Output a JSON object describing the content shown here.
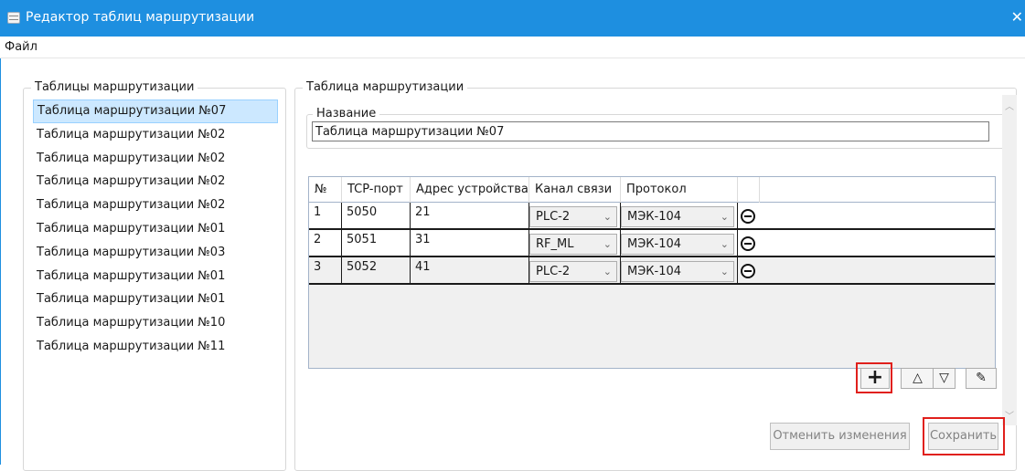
{
  "window": {
    "title": "Редактор таблиц маршрутизации",
    "close_glyph": "✕",
    "accent_color": "#1e8fe0",
    "icon": "table-app-icon"
  },
  "menu": {
    "file_label": "Файл"
  },
  "routes_panel": {
    "title": "Таблицы маршрутизации",
    "items": [
      "Таблица маршрутизации №07",
      "Таблица маршрутизации №02",
      "Таблица маршрутизации №02",
      "Таблица маршрутизации №02",
      "Таблица маршрутизации №02",
      "Таблица маршрутизации №01",
      "Таблица маршрутизации №03",
      "Таблица маршрутизации №01",
      "Таблица маршрутизации №01",
      "Таблица маршрутизации №10",
      "Таблица маршрутизации №11"
    ],
    "selected_index": 0
  },
  "table_panel": {
    "title": "Таблица маршрутизации",
    "name_label": "Название",
    "name_value": "Таблица маршрутизации №07",
    "columns": [
      "№",
      "TCP-порт",
      "Адрес устройства",
      "Канал связи",
      "Протокол"
    ],
    "rows": [
      {
        "num": "1",
        "port": "5050",
        "address": "21",
        "channel": "PLC-2",
        "protocol": "МЭК-104"
      },
      {
        "num": "2",
        "port": "5051",
        "address": "31",
        "channel": "RF_ML",
        "protocol": "МЭК-104"
      },
      {
        "num": "3",
        "port": "5052",
        "address": "41",
        "channel": "PLC-2",
        "protocol": "МЭК-104"
      }
    ],
    "selected_row": 2,
    "icons": {
      "add": "plus-icon",
      "up": "triangle-up-icon",
      "down": "triangle-down-icon",
      "clear": "eraser-icon",
      "remove": "minus-circle-icon",
      "dropdown": "chevron-down-icon"
    },
    "glyphs": {
      "add": "+",
      "up": "△",
      "down": "▽",
      "clear": "✎",
      "dropdown": "⌄",
      "scroll_up": "︿",
      "scroll_down": "﹀"
    }
  },
  "actions": {
    "cancel_label": "Отменить изменения",
    "save_label": "Сохранить",
    "highlight_color": "#e0201c"
  }
}
